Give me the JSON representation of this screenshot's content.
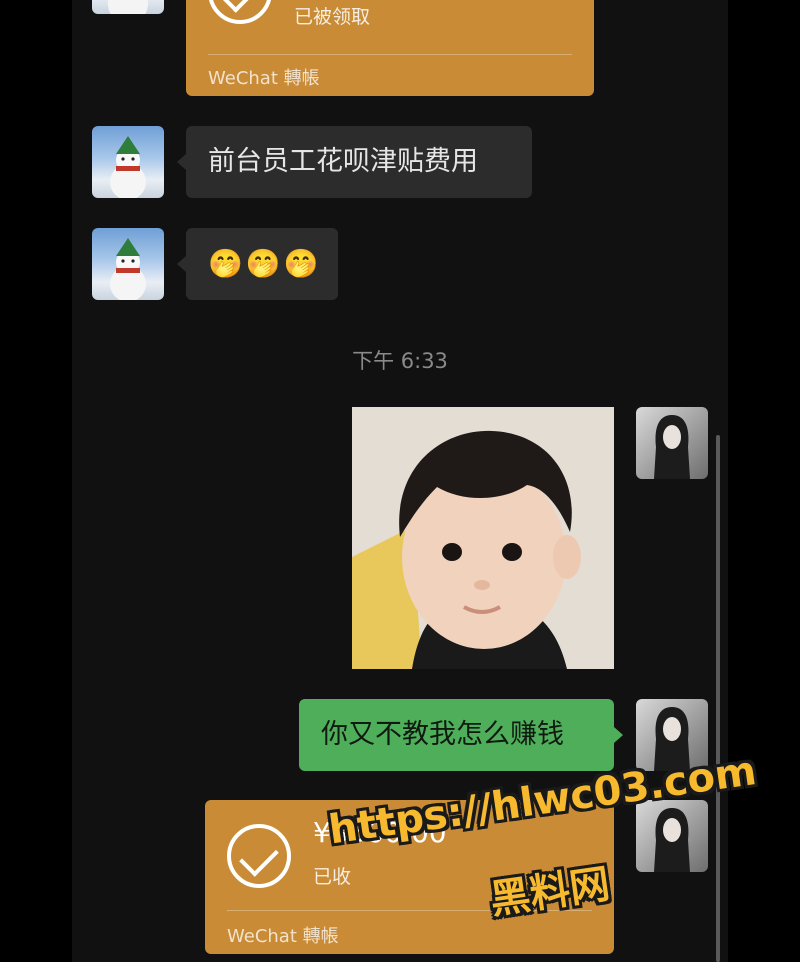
{
  "messages": {
    "transfer_top": {
      "status": "已被领取",
      "footer": "WeChat 轉帳"
    },
    "text_received": "前台员工花呗津贴费用",
    "emoji_received": "🤭🤭🤭",
    "timestamp": "下午 6:33",
    "text_sent": "你又不教我怎么赚钱",
    "transfer_sent": {
      "amount": "¥3500.00",
      "status": "已收",
      "footer": "WeChat 轉帳"
    }
  },
  "watermark": {
    "url": "https://hlwc03.com",
    "name": "黑料网"
  },
  "colors": {
    "background": "#111111",
    "bubble_received": "#2c2c2c",
    "bubble_sent": "#4eae5a",
    "transfer_card": "#c98b35",
    "watermark": "#f7b92e"
  },
  "icons": {
    "transfer": "check-circle-icon"
  }
}
